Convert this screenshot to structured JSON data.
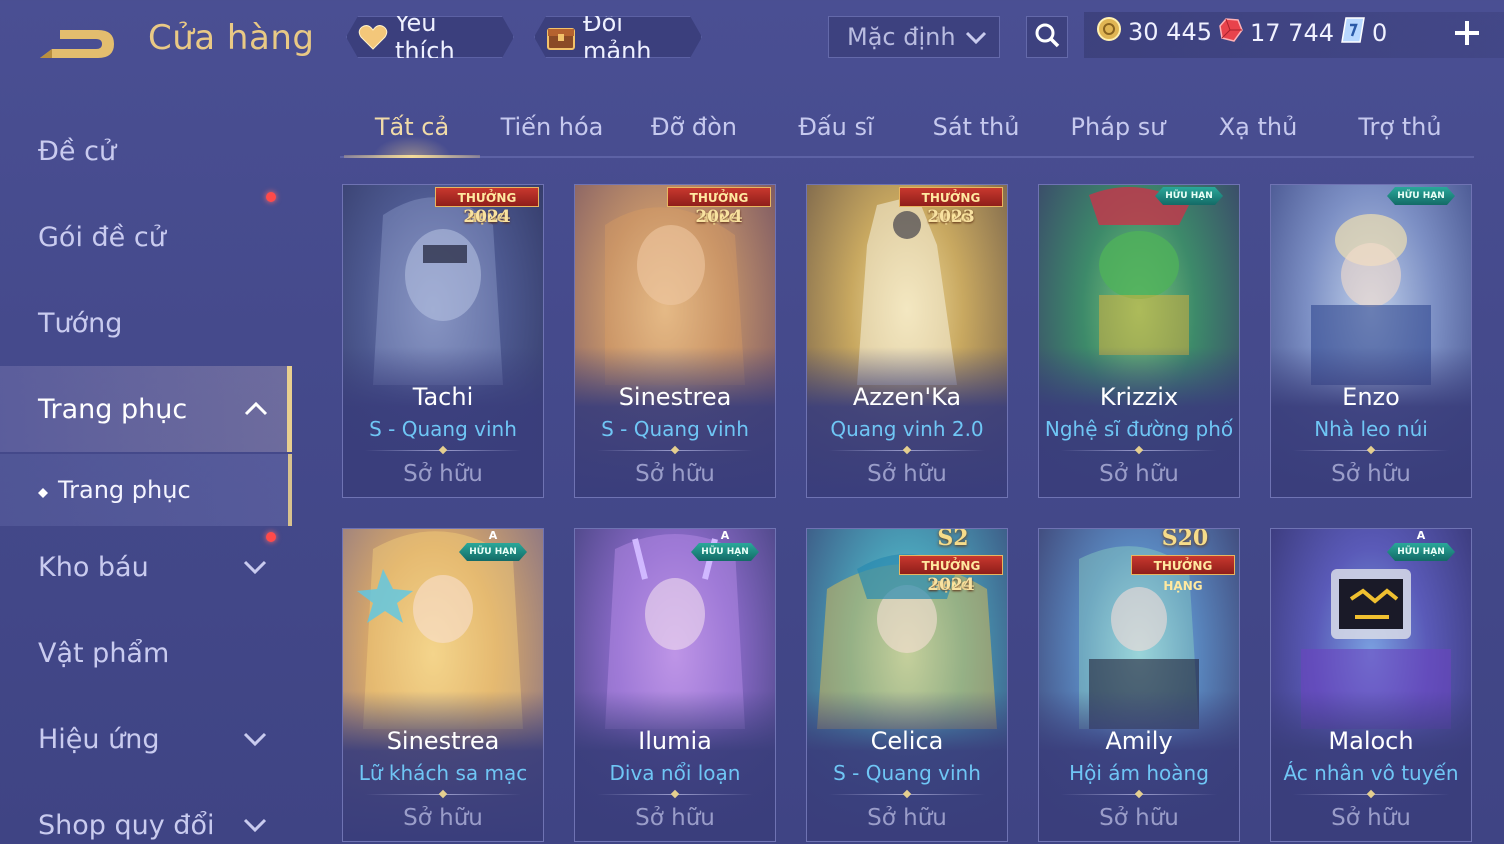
{
  "header": {
    "title": "Cửa hàng",
    "favorite_label": "Yêu thích",
    "exchange_label": "Đổi mảnh",
    "sort_value": "Mặc định",
    "currencies": {
      "gold": "30 445",
      "ruby": "17 744",
      "ticket": "0"
    }
  },
  "sidebar": {
    "items": [
      {
        "label": "Đề cử"
      },
      {
        "label": "Gói đề cử"
      },
      {
        "label": "Tướng"
      },
      {
        "label": "Trang phục"
      },
      {
        "label": "Kho báu"
      },
      {
        "label": "Vật phẩm"
      },
      {
        "label": "Hiệu ứng"
      },
      {
        "label": "Shop quy đổi"
      }
    ],
    "sub_item": "Trang phục"
  },
  "tabs": [
    {
      "label": "Tất cả"
    },
    {
      "label": "Tiến hóa"
    },
    {
      "label": "Đỡ đòn"
    },
    {
      "label": "Đấu sĩ"
    },
    {
      "label": "Sát thủ"
    },
    {
      "label": "Pháp sư"
    },
    {
      "label": "Xạ thủ"
    },
    {
      "label": "Trợ thủ"
    }
  ],
  "cards": [
    {
      "hero": "Tachi",
      "skin": "S - Quang vinh",
      "status": "Sở hữu",
      "badge_title": "THƯỞNG HẠNG",
      "badge_year": "2024"
    },
    {
      "hero": "Sinestrea",
      "skin": "S - Quang vinh",
      "status": "Sở hữu",
      "badge_title": "THƯỞNG HẠNG",
      "badge_year": "2024"
    },
    {
      "hero": "Azzen'Ka",
      "skin": "Quang vinh 2.0",
      "status": "Sở hữu",
      "badge_title": "THƯỞNG HẠNG",
      "badge_year": "2023"
    },
    {
      "hero": "Krizzix",
      "skin": "Nghệ sĩ đường phố",
      "status": "Sở hữu",
      "badge_limited": "HỮU HẠN"
    },
    {
      "hero": "Enzo",
      "skin": "Nhà leo núi",
      "status": "Sở hữu",
      "badge_limited": "HỮU HẠN"
    },
    {
      "hero": "Sinestrea",
      "skin": "Lữ khách sa mạc",
      "status": "Sở hữu",
      "badge_grade": "A",
      "badge_limited": "HỮU HẠN"
    },
    {
      "hero": "Ilumia",
      "skin": "Diva nổi loạn",
      "status": "Sở hữu",
      "badge_grade": "A",
      "badge_limited": "HỮU HẠN"
    },
    {
      "hero": "Celica",
      "skin": "S - Quang vinh",
      "status": "Sở hữu",
      "badge_season": "S2",
      "badge_title": "THƯỞNG HẠNG",
      "badge_year": "2024"
    },
    {
      "hero": "Amily",
      "skin": "Hội ám hoàng",
      "status": "Sở hữu",
      "badge_season": "S20",
      "badge_title": "THƯỞNG HẠNG"
    },
    {
      "hero": "Maloch",
      "skin": "Ác nhân vô tuyến",
      "status": "Sở hữu",
      "badge_grade": "A",
      "badge_limited": "HỮU HẠN"
    }
  ],
  "colors": {
    "background": "#464b8c",
    "title_gold": "#e9c985",
    "skin_blue": "#6fc6f5",
    "badge_red": "#c8382e",
    "badge_teal": "#2aa89a"
  }
}
